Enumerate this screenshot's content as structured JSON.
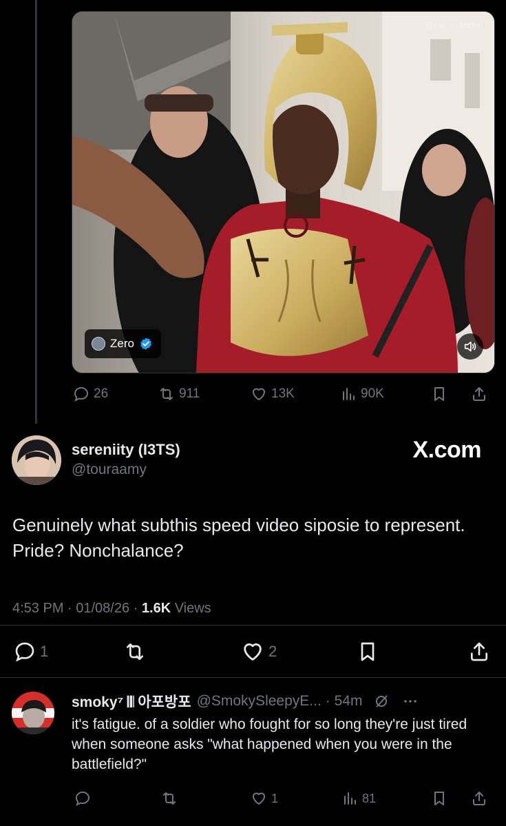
{
  "media": {
    "watermark": "@carl ... ntefeir",
    "chip_name": "Zero"
  },
  "quoted_actions": {
    "replies": "26",
    "reposts": "911",
    "likes": "13K",
    "views": "90K"
  },
  "tweet": {
    "display_name": "sereniity (I3TS)",
    "handle": "@touraamy",
    "brand": "X.com",
    "text": "Genuinely what subthis speed video siposie to represent. Pride? Nonchalance?",
    "time": "4:53 PM · 01/08/26 · ",
    "views_count": "1.6K",
    "views_label": " Views",
    "replies": "1",
    "likes": "2"
  },
  "reply": {
    "display_name": "smoky⁷ 𝄃𝄃 아포방포",
    "handle": "@SmokySleepyE...",
    "time": "· 54m",
    "text": "it's fatigue. of a soldier who fought for so long they're just tired when someone asks \"what happened when you were in the battlefield?\"",
    "likes": "1",
    "views": "81"
  },
  "colors": {
    "bg": "#000000",
    "text": "#e7e9ea",
    "muted": "#71767b",
    "accent": "#1d9bf0",
    "border": "#2f3336"
  }
}
